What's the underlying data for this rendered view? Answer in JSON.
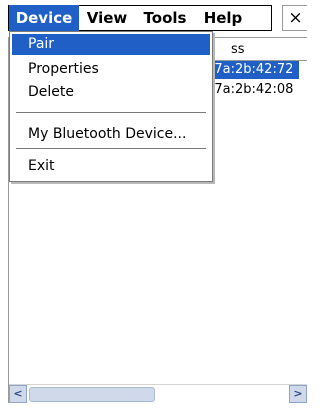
{
  "menubar": {
    "items": [
      {
        "label": "Device",
        "active": true
      },
      {
        "label": "View"
      },
      {
        "label": "Tools"
      },
      {
        "label": "Help"
      }
    ],
    "close_label": "×"
  },
  "list": {
    "header_address": "ss",
    "rows": [
      {
        "address": ":7a:2b:42:72",
        "selected": true
      },
      {
        "address": ":7a:2b:42:08",
        "selected": false
      }
    ]
  },
  "device_menu": {
    "items": [
      {
        "label": "Pair",
        "highlighted": true
      },
      {
        "label": "Properties"
      },
      {
        "label": "Delete"
      },
      {
        "label": "My Bluetooth Device..."
      },
      {
        "label": "Exit"
      }
    ]
  },
  "scrollbar": {
    "left_arrow": "<",
    "right_arrow": ">"
  },
  "colors": {
    "selection": "#1f5fc6",
    "scrollbar": "#cfd9ea"
  }
}
